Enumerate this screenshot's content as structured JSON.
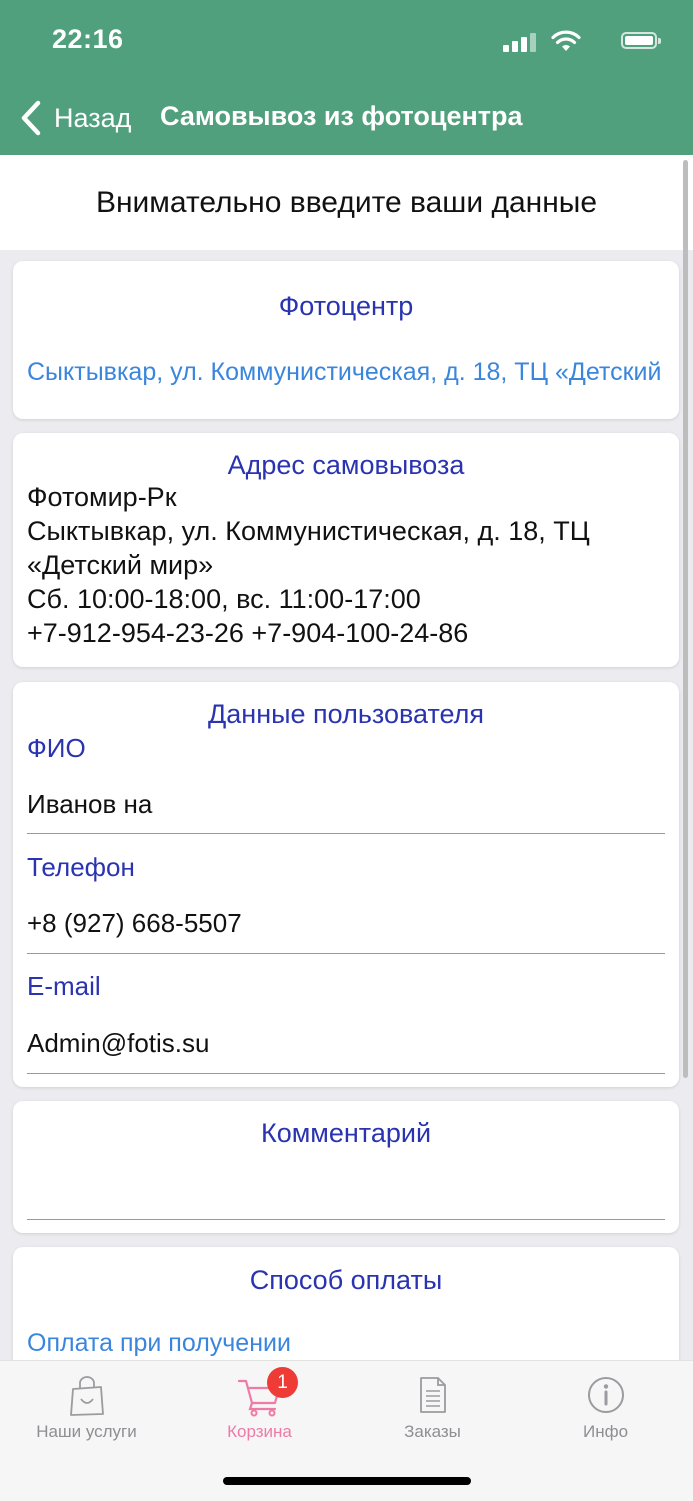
{
  "status_bar": {
    "time": "22:16"
  },
  "nav": {
    "back_label": "Назад",
    "title": "Самовывоз из фотоцентра"
  },
  "intro": "Внимательно введите ваши данные",
  "photocenter": {
    "title": "Фотоцентр",
    "value": "Сыктывкар, ул. Коммунистическая, д. 18, ТЦ «Детский"
  },
  "pickup": {
    "title": "Адрес самовывоза",
    "lines": [
      "Фотомир-Рк",
      "Сыктывкар, ул. Коммунистическая, д. 18, ТЦ",
      "«Детский мир»",
      "Сб. 10:00-18:00, вс. 11:00-17:00",
      "+7-912-954-23-26 +7-904-100-24-86"
    ]
  },
  "user": {
    "title": "Данные пользователя",
    "fio_label": "ФИО",
    "fio_value": "Иванов на",
    "phone_label": "Телефон",
    "phone_value": "+8 (927) 668-5507",
    "email_label": "E-mail",
    "email_value": "Admin@fotis.su"
  },
  "comment": {
    "title": "Комментарий",
    "value": ""
  },
  "payment": {
    "title": "Способ оплаты",
    "value": "Оплата при получении"
  },
  "tabs": [
    {
      "label": "Наши услуги",
      "icon": "shopping-bag-icon"
    },
    {
      "label": "Корзина",
      "icon": "cart-icon",
      "badge": "1",
      "active": true
    },
    {
      "label": "Заказы",
      "icon": "document-icon"
    },
    {
      "label": "Инфо",
      "icon": "info-icon"
    }
  ],
  "colors": {
    "header": "#51a07d",
    "accent_blue": "#2a33b0",
    "link_blue": "#3b86dd",
    "active_tab": "#f07aa6",
    "badge": "#ee3b36"
  }
}
